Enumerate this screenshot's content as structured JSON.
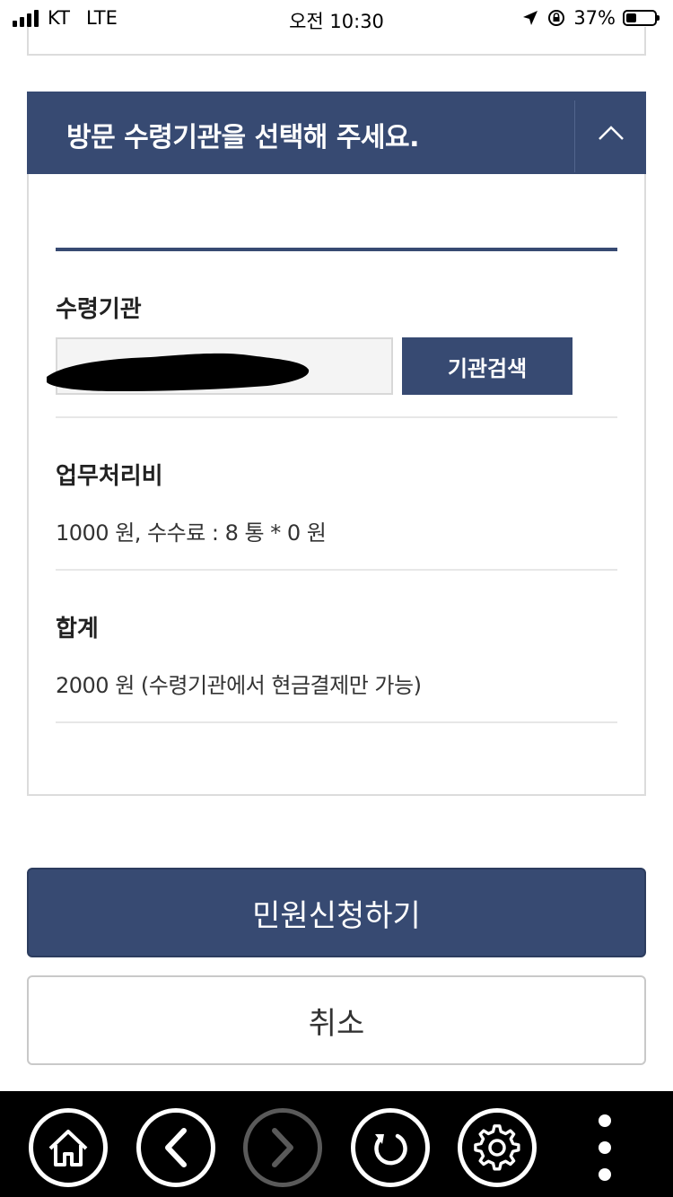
{
  "status_bar": {
    "carrier": "KT",
    "network": "LTE",
    "time": "오전 10:30",
    "battery_percent": "37%",
    "battery_level": 0.37
  },
  "panel": {
    "title": "방문 수령기관을 선택해 주세요.",
    "toggle_icon": "chevron-up-icon",
    "institution": {
      "label": "수령기관",
      "search_button": "기관검색"
    },
    "processing_fee": {
      "label": "업무처리비",
      "value": "1000 원, 수수료 : 8 통 * 0 원"
    },
    "total": {
      "label": "합계",
      "value": "2000 원 (수령기관에서 현금결제만 가능)"
    }
  },
  "actions": {
    "submit": "민원신청하기",
    "cancel": "취소"
  },
  "toolbar": {
    "icons": [
      "home-icon",
      "back-icon",
      "forward-icon",
      "reload-icon",
      "settings-icon",
      "more-icon"
    ]
  },
  "colors": {
    "primary": "#374a72",
    "border": "#dcdcdc",
    "toolbar_bg": "#000000"
  }
}
